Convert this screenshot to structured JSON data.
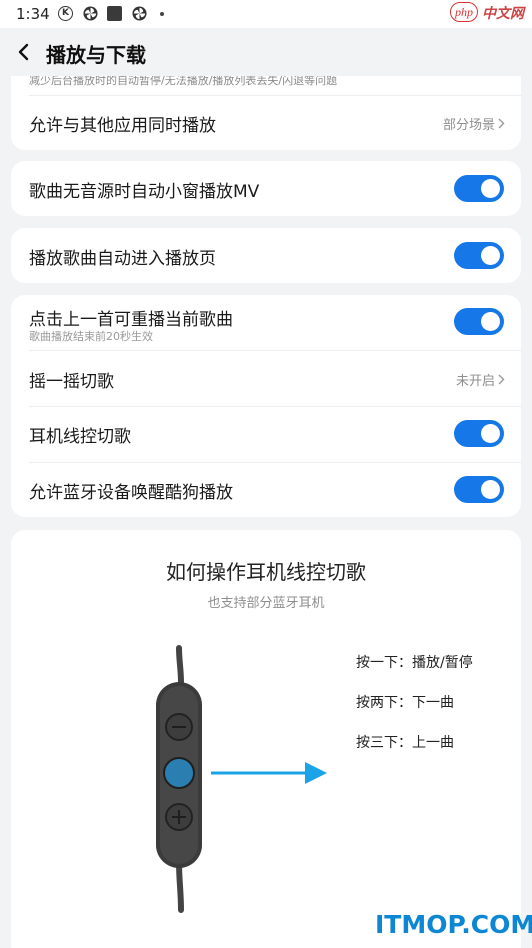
{
  "status_bar": {
    "time": "1:34",
    "k_icon_label": "K",
    "icons": [
      "k-circle-icon",
      "pinwheel-icon",
      "square-app-icon",
      "pinwheel-icon",
      "dot-icon"
    ]
  },
  "watermark_top": {
    "php": "php",
    "cn": "中文网"
  },
  "header": {
    "title": "播放与下载",
    "back_icon": "back-arrow-icon"
  },
  "card1": {
    "faded_text": "减少后台播放时的自动暂停/无法播放/播放列表丢失/闪退等问题",
    "allow_others": {
      "label": "允许与其他应用同时播放",
      "value": "部分场景"
    }
  },
  "card2": {
    "label": "歌曲无音源时自动小窗播放MV",
    "toggle_on": true
  },
  "card3": {
    "label": "播放歌曲自动进入播放页",
    "toggle_on": true
  },
  "card4": {
    "items": [
      {
        "label": "点击上一首可重播当前歌曲",
        "sub": "歌曲播放结束前20秒生效",
        "toggle_on": true
      },
      {
        "label": "摇一摇切歌",
        "value": "未开启"
      },
      {
        "label": "耳机线控切歌",
        "toggle_on": true
      },
      {
        "label": "允许蓝牙设备唤醒酷狗播放",
        "toggle_on": true
      }
    ]
  },
  "guide": {
    "title": "如何操作耳机线控切歌",
    "subtitle": "也支持部分蓝牙耳机",
    "instructions": [
      "按一下：播放/暂停",
      "按两下：下一曲",
      "按三下：上一曲"
    ]
  },
  "watermark_bottom": "ITMOP.COM",
  "colors": {
    "accent": "#1677e8",
    "background": "#f2f3f5",
    "card": "#ffffff",
    "arrow": "#1aa3e6",
    "button_center": "#2a7fb0"
  }
}
